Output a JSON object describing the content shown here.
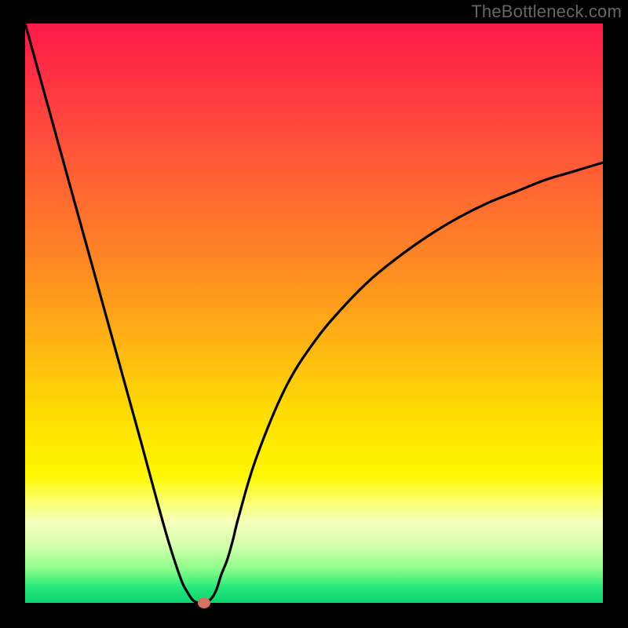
{
  "watermark": "TheBottleneck.com",
  "chart_data": {
    "type": "line",
    "title": "",
    "xlabel": "",
    "ylabel": "",
    "x_range": [
      0,
      100
    ],
    "y_range": [
      0,
      100
    ],
    "series": [
      {
        "name": "bottleneck-curve",
        "x": [
          0,
          5,
          10,
          15,
          20,
          23,
          25,
          27,
          28,
          29,
          30,
          31,
          32,
          33,
          34,
          35,
          36,
          37,
          40,
          45,
          50,
          55,
          60,
          65,
          70,
          75,
          80,
          85,
          90,
          95,
          100
        ],
        "values": [
          100,
          82,
          64,
          46,
          28,
          17,
          10,
          4,
          2,
          0.5,
          0,
          0,
          0.5,
          2,
          5,
          7.5,
          11,
          15,
          25,
          37,
          45,
          51,
          56,
          60,
          63.5,
          66.5,
          69,
          71,
          73,
          74.5,
          76
        ]
      }
    ],
    "marker": {
      "x": 31,
      "y": 0,
      "name": "optimal-point"
    },
    "colors": {
      "curve": "#000000",
      "marker": "#d67063",
      "frame": "#000000",
      "gradient_top": "#ff1a49",
      "gradient_bottom": "#0ed46e"
    }
  }
}
